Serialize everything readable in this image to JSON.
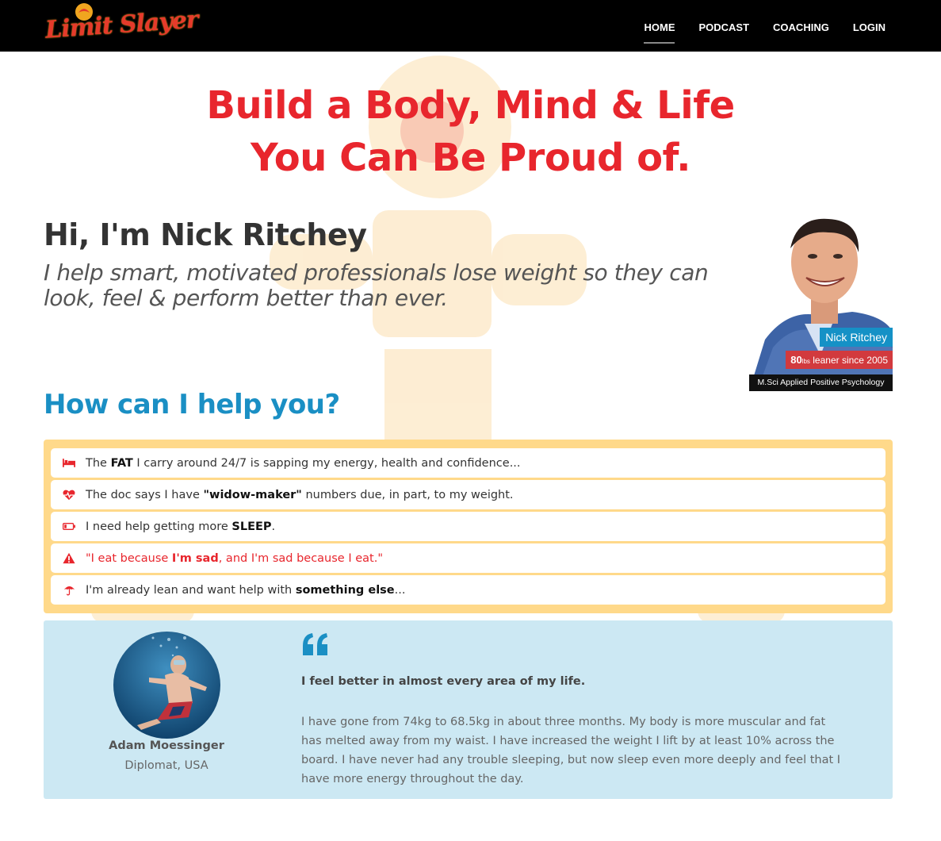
{
  "brand": {
    "logo_text": "Limit Slayer",
    "accent": "#e53a2b",
    "accent2": "#f0a51f"
  },
  "nav": {
    "items": [
      {
        "label": "HOME",
        "active": true
      },
      {
        "label": "PODCAST",
        "active": false
      },
      {
        "label": "COACHING",
        "active": false
      },
      {
        "label": "LOGIN",
        "active": false
      }
    ]
  },
  "hero": {
    "line1": "Build a Body, Mind & Life",
    "line2": "You Can Be Proud of.",
    "color": "#e8262d"
  },
  "intro": {
    "name": "Hi, I'm Nick Ritchey",
    "subtitle": "I help smart, motivated professionals lose weight so they can look, feel & perform better than ever."
  },
  "profile": {
    "badge_name": "Nick Ritchey",
    "lean_number": "80",
    "lean_unit": "lbs",
    "lean_text": " leaner since 2005",
    "credential": "M.Sci Applied Positive Psychology"
  },
  "help": {
    "title": "How can I help you?",
    "items": [
      {
        "icon": "bed-icon",
        "pre": "The ",
        "bold": "FAT",
        "post": " I carry around 24/7 is sapping my energy, health and confidence..."
      },
      {
        "icon": "heartbeat-icon",
        "pre": "The doc says I have ",
        "bold": "\"widow-maker\"",
        "post": " numbers due, in part, to my weight."
      },
      {
        "icon": "battery-low-icon",
        "pre": "I need help getting more ",
        "bold": "SLEEP",
        "post": "."
      },
      {
        "icon": "warning-icon",
        "pre": "\"I eat because ",
        "bold": "I'm sad",
        "post": ", and I'm sad because I eat.\""
      },
      {
        "icon": "umbrella-icon",
        "pre": "I'm already lean and want help with ",
        "bold": "something else",
        "post": "..."
      }
    ]
  },
  "testimonial": {
    "name": "Adam Moessinger",
    "role": "Diplomat, USA",
    "headline": "I feel better in almost every area of my life.",
    "body": "I have gone from 74kg to 68.5kg in about three months. My body is more muscular and fat has melted away from my waist. I have increased the weight I lift by at least 10% across the board. I have never had any trouble sleeping, but now sleep even more deeply and feel that I have more energy throughout the day."
  }
}
